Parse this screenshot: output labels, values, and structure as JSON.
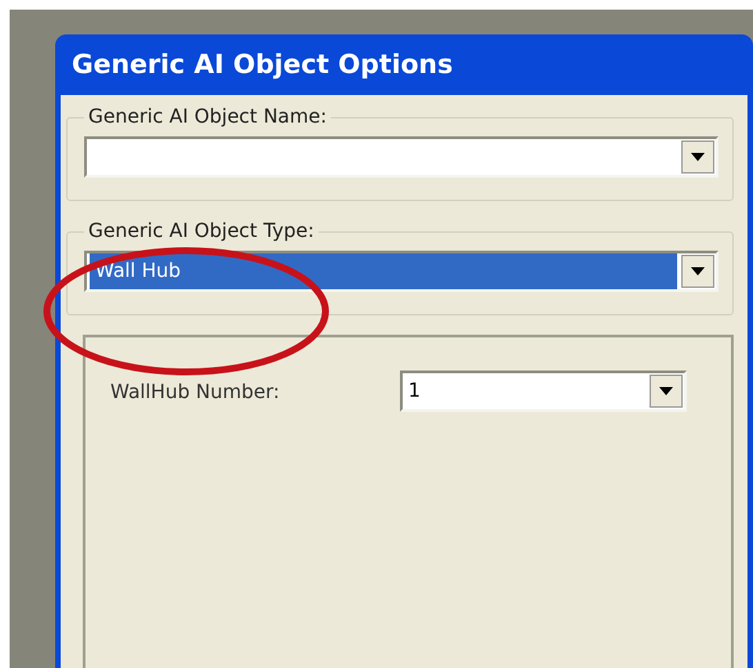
{
  "window": {
    "title": "Generic AI Object Options"
  },
  "name_group": {
    "label": "Generic AI Object Name:",
    "combo": {
      "selected": false
    }
  },
  "type_group": {
    "label": "Generic AI Object Type:",
    "combo": {
      "value": "Wall Hub",
      "selected": true
    }
  },
  "settings_panel": {
    "fields": [
      {
        "label": "WallHub Number:",
        "value": "1",
        "selected": false
      }
    ]
  },
  "annotation": {
    "kind": "ellipse",
    "color": "#c8121a"
  }
}
